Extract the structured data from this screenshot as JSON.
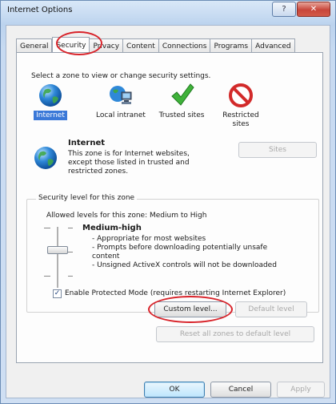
{
  "window": {
    "title": "Internet Options",
    "help_symbol": "?",
    "close_symbol": "✕"
  },
  "tabs": [
    {
      "label": "General"
    },
    {
      "label": "Security"
    },
    {
      "label": "Privacy"
    },
    {
      "label": "Content"
    },
    {
      "label": "Connections"
    },
    {
      "label": "Programs"
    },
    {
      "label": "Advanced"
    }
  ],
  "security": {
    "instruction": "Select a zone to view or change security settings.",
    "zones": [
      {
        "label": "Internet",
        "icon": "globe-icon",
        "selected": true
      },
      {
        "label": "Local intranet",
        "icon": "intranet-icon"
      },
      {
        "label": "Trusted sites",
        "icon": "checkmark-icon"
      },
      {
        "label": "Restricted sites",
        "icon": "restricted-icon"
      }
    ],
    "zone_title": "Internet",
    "zone_description": "This zone is for Internet websites, except those listed in trusted and restricted zones.",
    "sites_button": "Sites",
    "level_group_title": "Security level for this zone",
    "allowed_levels": "Allowed levels for this zone: Medium to High",
    "level_name": "Medium-high",
    "level_details": [
      "- Appropriate for most websites",
      "- Prompts before downloading potentially unsafe content",
      "- Unsigned ActiveX controls will not be downloaded"
    ],
    "protected_mode_label": "Enable Protected Mode (requires restarting Internet Explorer)",
    "protected_mode_checked": true,
    "custom_level_button": "Custom level...",
    "default_level_button": "Default level",
    "reset_all_button": "Reset all zones to default level"
  },
  "footer": {
    "ok": "OK",
    "cancel": "Cancel",
    "apply": "Apply"
  }
}
